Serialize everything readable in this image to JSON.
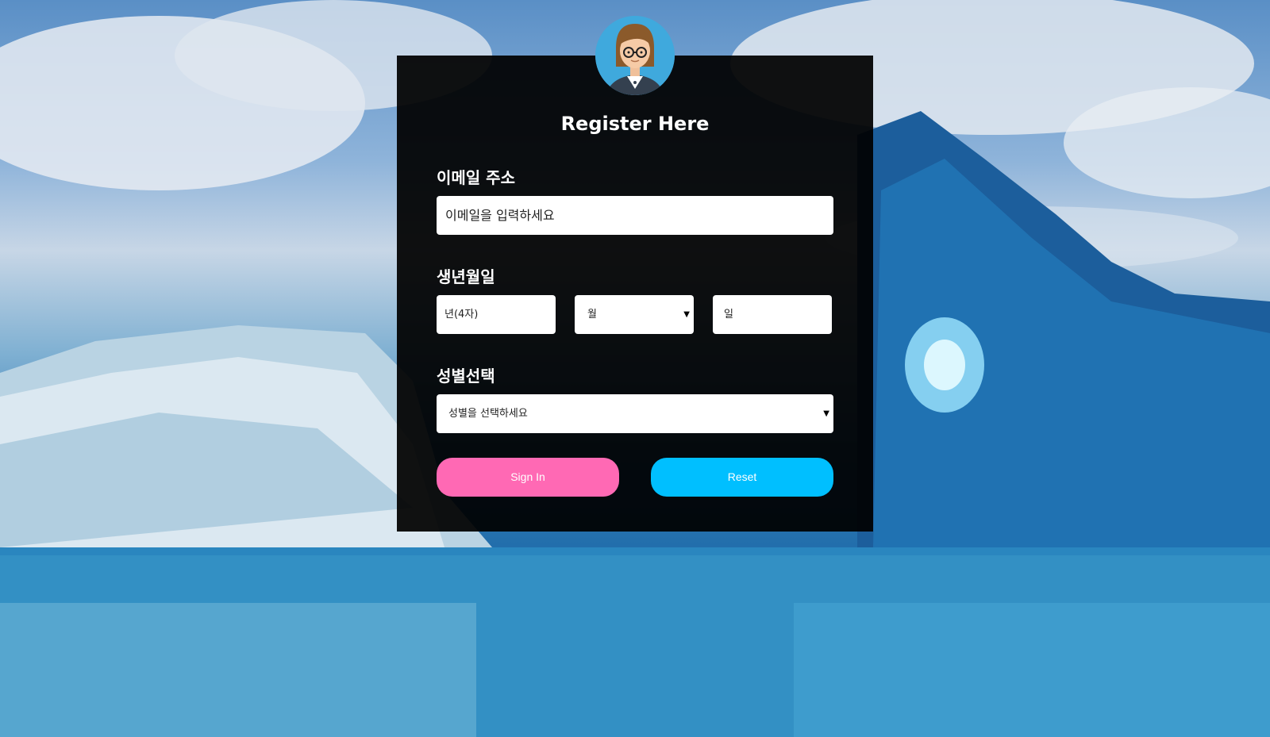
{
  "form": {
    "title": "Register Here",
    "email_label": "이메일 주소",
    "email_placeholder": "이메일을 입력하세요",
    "birth_label": "생년월일",
    "year_placeholder": "년(4자)",
    "month_selected": "월",
    "day_placeholder": "일",
    "gender_label": "성별선택",
    "gender_selected": "성별을 선택하세요",
    "signin_label": "Sign In",
    "reset_label": "Reset"
  },
  "colors": {
    "signin": "#ff69b4",
    "reset": "#00bfff",
    "card": "#000000"
  },
  "icons": {
    "avatar": "user-avatar-icon",
    "dropdown": "dropdown-arrow-icon"
  }
}
